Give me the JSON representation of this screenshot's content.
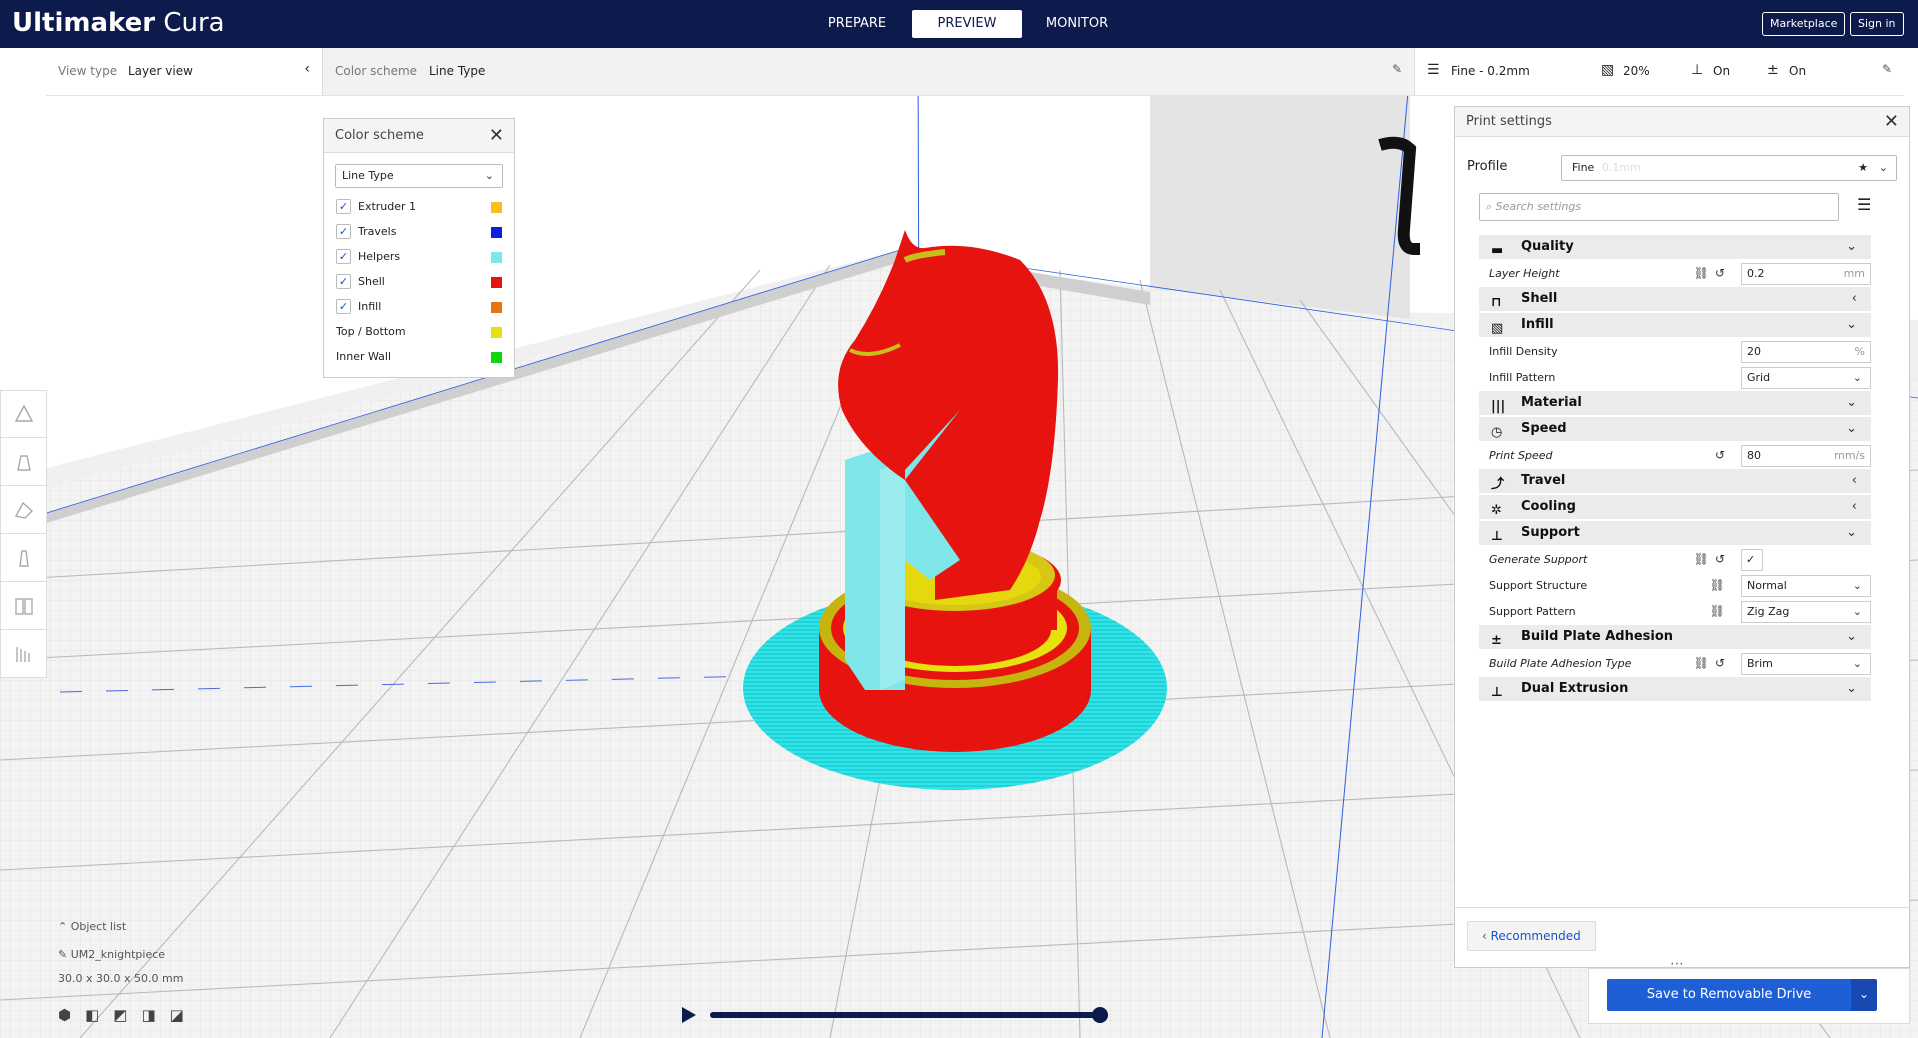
{
  "app": {
    "name_bold": "Ultimaker",
    "name_rest": " Cura"
  },
  "stages": [
    {
      "label": "PREPARE",
      "active": false
    },
    {
      "label": "PREVIEW",
      "active": true
    },
    {
      "label": "MONITOR",
      "active": false
    }
  ],
  "header_buttons": {
    "marketplace": "Marketplace",
    "signin": "Sign in"
  },
  "view_type": {
    "label": "View type",
    "value": "Layer view"
  },
  "color_scheme_bar": {
    "label": "Color scheme",
    "value": "Line Type"
  },
  "print_summary": {
    "profile": "Fine - 0.2mm",
    "infill": "20%",
    "support": "On",
    "adhesion": "On"
  },
  "color_scheme_panel": {
    "title": "Color scheme",
    "selected": "Line Type",
    "items": [
      {
        "label": "Extruder 1",
        "checked": true,
        "color": "#f7c11a"
      },
      {
        "label": "Travels",
        "checked": true,
        "color": "#0a1ee6"
      },
      {
        "label": "Helpers",
        "checked": true,
        "color": "#7fe6ea"
      },
      {
        "label": "Shell",
        "checked": true,
        "color": "#e6130f"
      },
      {
        "label": "Infill",
        "checked": true,
        "color": "#e8730f"
      },
      {
        "label": "Top / Bottom",
        "checked": null,
        "color": "#e6e10f"
      },
      {
        "label": "Inner Wall",
        "checked": null,
        "color": "#10d610"
      }
    ]
  },
  "print_settings": {
    "title": "Print settings",
    "profile_label": "Profile",
    "profile_value": "Fine",
    "profile_hint": "0.1mm",
    "search_placeholder": "Search settings",
    "sections": {
      "quality": "Quality",
      "shell": "Shell",
      "infill": "Infill",
      "material": "Material",
      "speed": "Speed",
      "travel": "Travel",
      "cooling": "Cooling",
      "support": "Support",
      "adhesion": "Build Plate Adhesion",
      "dual": "Dual Extrusion"
    },
    "settings": {
      "layer_height": {
        "label": "Layer Height",
        "value": "0.2",
        "unit": "mm"
      },
      "infill_density": {
        "label": "Infill Density",
        "value": "20",
        "unit": "%"
      },
      "infill_pattern": {
        "label": "Infill Pattern",
        "value": "Grid"
      },
      "print_speed": {
        "label": "Print Speed",
        "value": "80",
        "unit": "mm/s"
      },
      "generate_support": {
        "label": "Generate Support",
        "checked": true
      },
      "support_structure": {
        "label": "Support Structure",
        "value": "Normal"
      },
      "support_pattern": {
        "label": "Support Pattern",
        "value": "Zig Zag"
      },
      "adhesion_type": {
        "label": "Build Plate Adhesion Type",
        "value": "Brim"
      }
    },
    "recommended_button": "Recommended"
  },
  "save_button": "Save to Removable Drive",
  "object_list": {
    "title": "Object list",
    "object_name": "UM2_knightpiece",
    "dimensions": "30.0 x 30.0 x 50.0 mm"
  },
  "layer_progress": 1.0
}
